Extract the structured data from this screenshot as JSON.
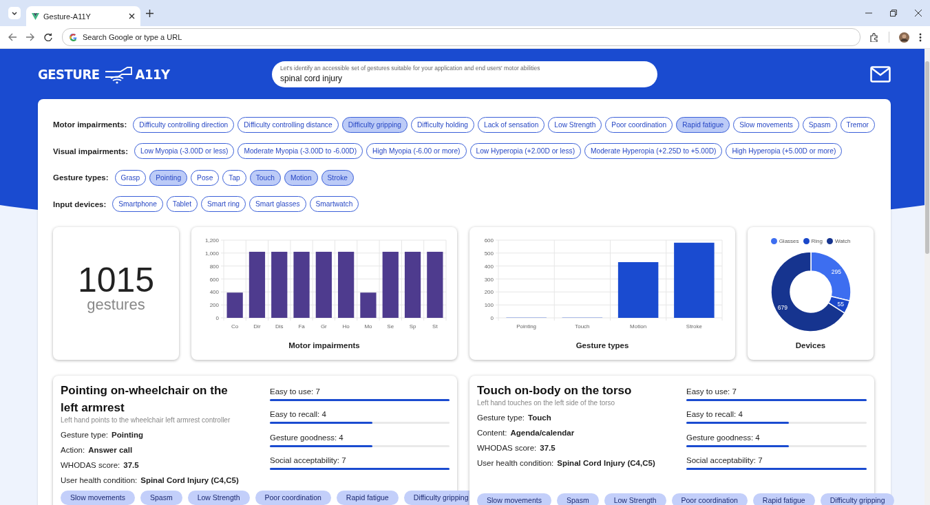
{
  "browser": {
    "tab": {
      "title": "Gesture-A11Y",
      "selected": true
    },
    "address_bar": {
      "placeholder": "Search Google or type a URL"
    }
  },
  "header": {
    "logo": {
      "left": "GESTURE",
      "right": "A11Y"
    },
    "search": {
      "label": "Let's identify an accessible set of gestures suitable for your application and end users' motor abilities",
      "value": "spinal cord injury"
    }
  },
  "filters": [
    {
      "label": "Motor impairments:",
      "chips": [
        {
          "text": "Difficulty controlling direction",
          "selected": false
        },
        {
          "text": "Difficulty controlling distance",
          "selected": false
        },
        {
          "text": "Difficulty gripping",
          "selected": true
        },
        {
          "text": "Difficulty holding",
          "selected": false
        },
        {
          "text": "Lack of sensation",
          "selected": false
        },
        {
          "text": "Low Strength",
          "selected": false
        },
        {
          "text": "Poor coordination",
          "selected": false
        },
        {
          "text": "Rapid fatigue",
          "selected": true
        },
        {
          "text": "Slow movements",
          "selected": false
        },
        {
          "text": "Spasm",
          "selected": false
        },
        {
          "text": "Tremor",
          "selected": false
        }
      ]
    },
    {
      "label": "Visual impairments:",
      "chips": [
        {
          "text": "Low Myopia (-3.00D or less)",
          "selected": false
        },
        {
          "text": "Moderate Myopia (-3.00D to -6.00D)",
          "selected": false
        },
        {
          "text": "High Myopia (-6.00 or more)",
          "selected": false
        },
        {
          "text": "Low Hyperopia (+2.00D or less)",
          "selected": false
        },
        {
          "text": "Moderate Hyperopia (+2.25D to +5.00D)",
          "selected": false
        },
        {
          "text": "High Hyperopia (+5.00D or more)",
          "selected": false
        }
      ]
    },
    {
      "label": "Gesture types:",
      "chips": [
        {
          "text": "Grasp",
          "selected": false
        },
        {
          "text": "Pointing",
          "selected": true
        },
        {
          "text": "Pose",
          "selected": false
        },
        {
          "text": "Tap",
          "selected": false
        },
        {
          "text": "Touch",
          "selected": true
        },
        {
          "text": "Motion",
          "selected": true
        },
        {
          "text": "Stroke",
          "selected": true
        }
      ]
    },
    {
      "label": "Input devices:",
      "chips": [
        {
          "text": "Smartphone",
          "selected": false
        },
        {
          "text": "Tablet",
          "selected": false
        },
        {
          "text": "Smart ring",
          "selected": false
        },
        {
          "text": "Smart glasses",
          "selected": false
        },
        {
          "text": "Smartwatch",
          "selected": false
        }
      ]
    }
  ],
  "summary": {
    "count": "1015",
    "unit": "gestures"
  },
  "motor_chart": {
    "chart_data": {
      "type": "bar",
      "title": "Motor impairments",
      "categories": [
        "Co",
        "Dir",
        "Dis",
        "Fa",
        "Gr",
        "Ho",
        "Mo",
        "Se",
        "Sp",
        "St"
      ],
      "series": [
        {
          "color": "#4e3b8e",
          "values": [
            390,
            1020,
            1020,
            1020,
            1020,
            1020,
            390,
            1020,
            1020,
            1020
          ]
        }
      ],
      "grid": true,
      "ylim": [
        0,
        1200
      ],
      "yticks": [
        0,
        {
          "value": 200,
          "label": "200"
        },
        {
          "value": 400,
          "label": "400"
        },
        {
          "value": 600,
          "label": "600"
        },
        {
          "value": 800,
          "label": "800"
        },
        {
          "value": 1000,
          "label": "1,000"
        },
        {
          "value": 1200,
          "label": "1,200"
        }
      ]
    }
  },
  "gesture_chart": {
    "chart_data": {
      "type": "bar",
      "title": "Gesture types",
      "categories": [
        "Pointing",
        "Touch",
        "Motion",
        "Stroke"
      ],
      "series": [
        {
          "color": "#1a4bd0",
          "values": [
            5,
            5,
            430,
            580
          ]
        }
      ],
      "grid": true,
      "ylim": [
        0,
        600
      ],
      "yticks": [
        0,
        100,
        200,
        300,
        400,
        500,
        600
      ]
    }
  },
  "device_chart": {
    "chart_data": {
      "type": "donut",
      "title": "Devices",
      "categories": [
        "Glasses",
        "Ring",
        "Watch"
      ],
      "values": [
        295,
        55,
        679
      ],
      "colors": [
        "#3d6ef0",
        "#1a47c9",
        "#16348f"
      ],
      "data_labels": true
    }
  },
  "gestures": [
    {
      "title": "Pointing on-wheelchair on the left armrest",
      "description": "Left hand points to the wheelchair left armrest controller",
      "details": [
        {
          "label": "Gesture type:",
          "value": "Pointing"
        },
        {
          "label": "Action:",
          "value": "Answer call"
        },
        {
          "label": "WHODAS score:",
          "value": "37.5"
        },
        {
          "label": "User health condition:",
          "value": "Spinal Cord Injury (C4,C5)"
        }
      ],
      "ratings": [
        {
          "label": "Easy to use: 7",
          "level": 1
        },
        {
          "label": "Easy to recall: 4",
          "level": 0.57
        },
        {
          "label": "Gesture goodness: 4",
          "level": 0.57
        },
        {
          "label": "Social acceptability: 7",
          "level": 1
        }
      ],
      "tags": [
        "Slow movements",
        "Spasm",
        "Low Strength",
        "Poor coordination",
        "Rapid fatigue",
        "Difficulty gripping"
      ]
    },
    {
      "title": "Touch on-body on the torso",
      "description": "Left hand touches on the left side of the torso",
      "details": [
        {
          "label": "Gesture type:",
          "value": "Touch"
        },
        {
          "label": "Content:",
          "value": "Agenda/calendar"
        },
        {
          "label": "WHODAS score:",
          "value": "37.5"
        },
        {
          "label": "User health condition:",
          "value": "Spinal Cord Injury (C4,C5)"
        }
      ],
      "ratings": [
        {
          "label": "Easy to use: 7",
          "level": 1
        },
        {
          "label": "Easy to recall: 4",
          "level": 0.57
        },
        {
          "label": "Gesture goodness: 4",
          "level": 0.57
        },
        {
          "label": "Social acceptability: 7",
          "level": 1
        }
      ],
      "tags": [
        "Slow movements",
        "Spasm",
        "Low Strength",
        "Poor coordination",
        "Rapid fatigue",
        "Difficulty gripping"
      ]
    }
  ]
}
